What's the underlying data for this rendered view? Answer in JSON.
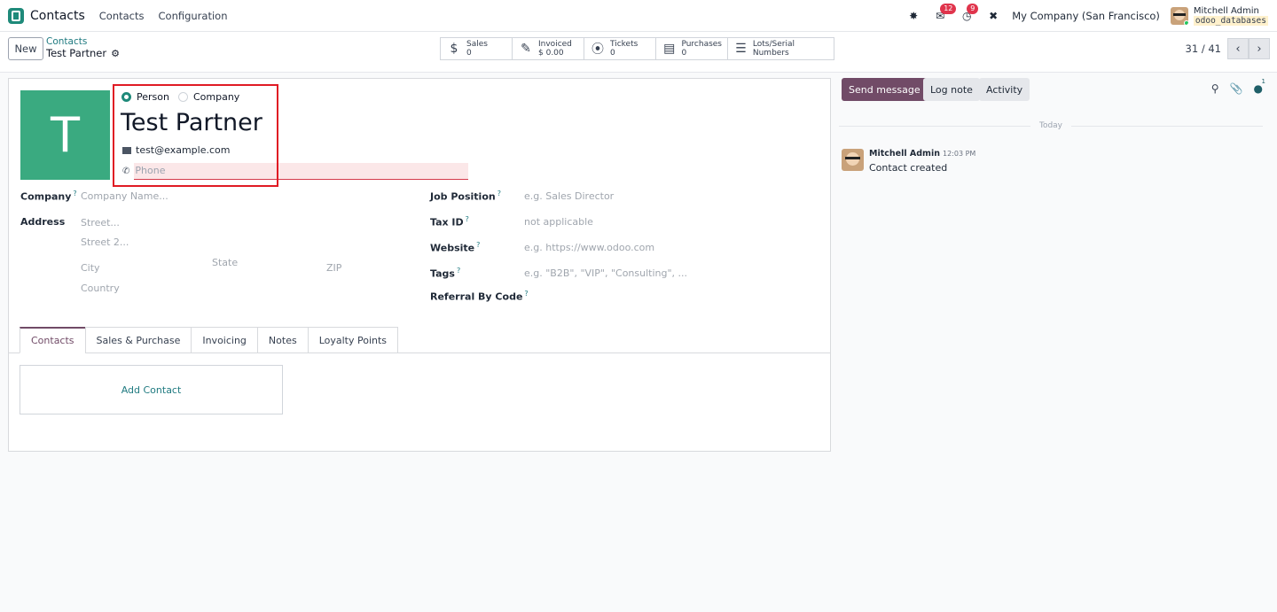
{
  "navbar": {
    "app_name": "Contacts",
    "menu": [
      "Contacts",
      "Configuration"
    ],
    "messages_badge": "12",
    "activities_badge": "9",
    "company": "My Company (San Francisco)",
    "user_name": "Mitchell Admin",
    "database": "odoo_databases"
  },
  "control": {
    "new_label": "New",
    "breadcrumb_parent": "Contacts",
    "breadcrumb_current": "Test Partner",
    "pager": "31 / 41",
    "smart_buttons": [
      {
        "label": "Sales",
        "value": "0",
        "icon": "dollar-icon"
      },
      {
        "label": "Invoiced",
        "value": "$ 0.00",
        "icon": "edit-icon"
      },
      {
        "label": "Tickets",
        "value": "0",
        "icon": "lifebuoy-icon"
      },
      {
        "label": "Purchases",
        "value": "0",
        "icon": "credit-card-icon"
      },
      {
        "label": "Lots/Serial Numbers",
        "value": "",
        "icon": "bars-icon"
      }
    ]
  },
  "form": {
    "avatar_letter": "T",
    "type_person": "Person",
    "type_company": "Company",
    "name": "Test Partner",
    "email": "test@example.com",
    "phone_placeholder": "Phone",
    "company_label": "Company",
    "company_placeholder": "Company Name...",
    "address_label": "Address",
    "street_placeholder": "Street...",
    "street2_placeholder": "Street 2...",
    "city_placeholder": "City",
    "state_placeholder": "State",
    "zip_placeholder": "ZIP",
    "country_placeholder": "Country",
    "job_position_label": "Job Position",
    "job_position_placeholder": "e.g. Sales Director",
    "tax_id_label": "Tax ID",
    "tax_id_placeholder": "not applicable",
    "website_label": "Website",
    "website_placeholder": "e.g. https://www.odoo.com",
    "tags_label": "Tags",
    "tags_placeholder": "e.g. \"B2B\", \"VIP\", \"Consulting\", ...",
    "referral_label": "Referral By Code",
    "help_mark": "?"
  },
  "tabs": [
    "Contacts",
    "Sales & Purchase",
    "Invoicing",
    "Notes",
    "Loyalty Points"
  ],
  "add_contact": "Add Contact",
  "chatter": {
    "send_message": "Send message",
    "log_note": "Log note",
    "activity": "Activity",
    "followers_count": "1",
    "separator": "Today",
    "message_author": "Mitchell Admin",
    "message_time": "12:03 PM",
    "message_text": "Contact created"
  },
  "colors": {
    "brand": "#714b67",
    "accent": "#1f7a80",
    "avatar_bg": "#3aaa80",
    "highlight_box": "#e01b24"
  }
}
